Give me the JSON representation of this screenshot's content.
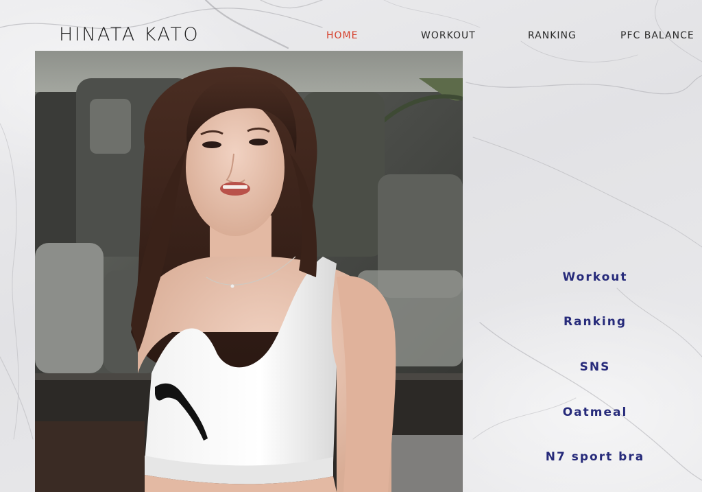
{
  "site": {
    "logo": "HINATA KATO"
  },
  "nav": {
    "items": [
      {
        "label": "HOME",
        "active": true
      },
      {
        "label": "WORKOUT",
        "active": false
      },
      {
        "label": "RANKING",
        "active": false
      },
      {
        "label": "PFC BALANCE",
        "active": false
      }
    ]
  },
  "side_menu": {
    "items": [
      {
        "label": "Workout"
      },
      {
        "label": "Ranking"
      },
      {
        "label": "SNS"
      },
      {
        "label": "Oatmeal"
      },
      {
        "label": "N7 sport bra"
      }
    ]
  },
  "colors": {
    "nav_active": "#d6402c",
    "nav_default": "#2a2a2a",
    "side_menu_text": "#262a7a",
    "logo": "#1b1b1b"
  }
}
